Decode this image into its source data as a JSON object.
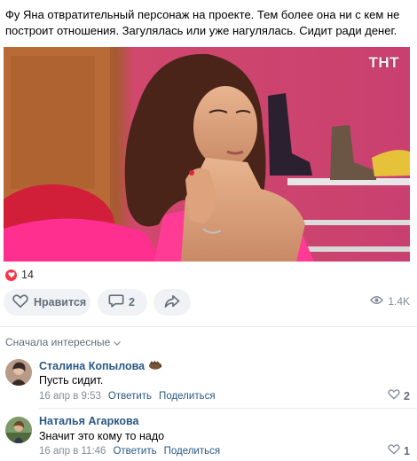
{
  "post": {
    "text": "Фу Яна отвратительный персонаж на проекте. Тем более она ни с кем не построит отношения. Загулялась или уже нагулялась. Сидит ради денег.",
    "image": {
      "channel_logo": "ТНТ",
      "description_icon": "tv-still-photo"
    },
    "likes_count": "14",
    "actions": {
      "like_label": "Нравится",
      "comments_count": "2",
      "views_count": "1.4K"
    }
  },
  "comments_section": {
    "sort_label": "Сначала интересные",
    "items": [
      {
        "author": "Сталина Копылова",
        "text": "Пусть сидит.",
        "date": "16 апр в 9:53",
        "reply_label": "Ответить",
        "share_label": "Поделиться",
        "likes": "2"
      },
      {
        "author": "Наталья Агаркова",
        "text": "Значит это кому то надо",
        "date": "16 апр в 11:46",
        "reply_label": "Ответить",
        "share_label": "Поделиться",
        "likes": "1"
      }
    ]
  },
  "colors": {
    "link": "#2a5885",
    "like_red": "#ff3347",
    "pill_bg": "#f0f2f5",
    "meta_gray": "#818c99"
  },
  "icons": [
    "heart-icon",
    "comment-icon",
    "share-icon",
    "eye-icon",
    "chevron-down-icon",
    "hedgehog-emoji-icon"
  ]
}
